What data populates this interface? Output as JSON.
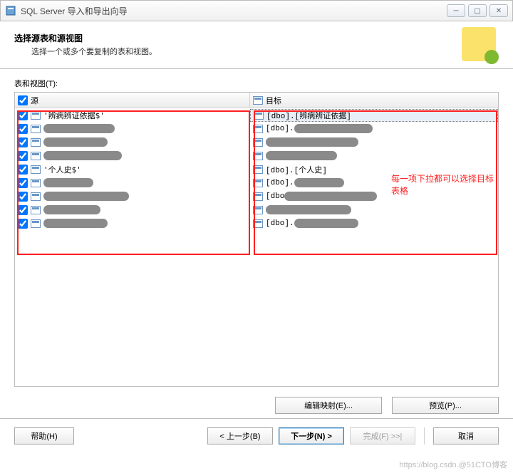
{
  "window": {
    "title": "SQL Server 导入和导出向导"
  },
  "header": {
    "title": "选择源表和源视图",
    "subtitle": "选择一个或多个要复制的表和视图。"
  },
  "tv_label": "表和视图(T):",
  "columns": {
    "source": "源",
    "target": "目标"
  },
  "annotation": "每一项下拉都可以选择目标表格",
  "rows": [
    {
      "checked": true,
      "src_text": "'辨病辨证依据$'",
      "src_redact": 0,
      "dst_text": "[dbo].[辨病辨证依据]",
      "dst_redact": 0
    },
    {
      "checked": true,
      "src_text": "",
      "src_redact": 100,
      "dst_text": "[dbo].",
      "dst_redact": 110
    },
    {
      "checked": true,
      "src_text": "",
      "src_redact": 90,
      "dst_text": "",
      "dst_redact": 130
    },
    {
      "checked": true,
      "src_text": "",
      "src_redact": 110,
      "dst_text": "",
      "dst_redact": 100
    },
    {
      "checked": true,
      "src_text": "'个人史$'",
      "src_redact": 0,
      "dst_text": "[dbo].[个人史]",
      "dst_redact": 0
    },
    {
      "checked": true,
      "src_text": "",
      "src_redact": 70,
      "dst_text": "[dbo].",
      "dst_redact": 70
    },
    {
      "checked": true,
      "src_text": "",
      "src_redact": 120,
      "dst_text": "[dbo",
      "dst_redact": 130
    },
    {
      "checked": true,
      "src_text": "",
      "src_redact": 80,
      "dst_text": "",
      "dst_redact": 120
    },
    {
      "checked": true,
      "src_text": "",
      "src_redact": 90,
      "dst_text": "[dbo].",
      "dst_redact": 90
    }
  ],
  "buttons": {
    "edit_map": "编辑映射(E)...",
    "preview": "预览(P)...",
    "help": "帮助(H)",
    "back": "< 上一步(B)",
    "next": "下一步(N) >",
    "finish": "完成(F) >>|",
    "cancel": "取消"
  },
  "watermark": "https://blog.csdn.@51CTO博客"
}
